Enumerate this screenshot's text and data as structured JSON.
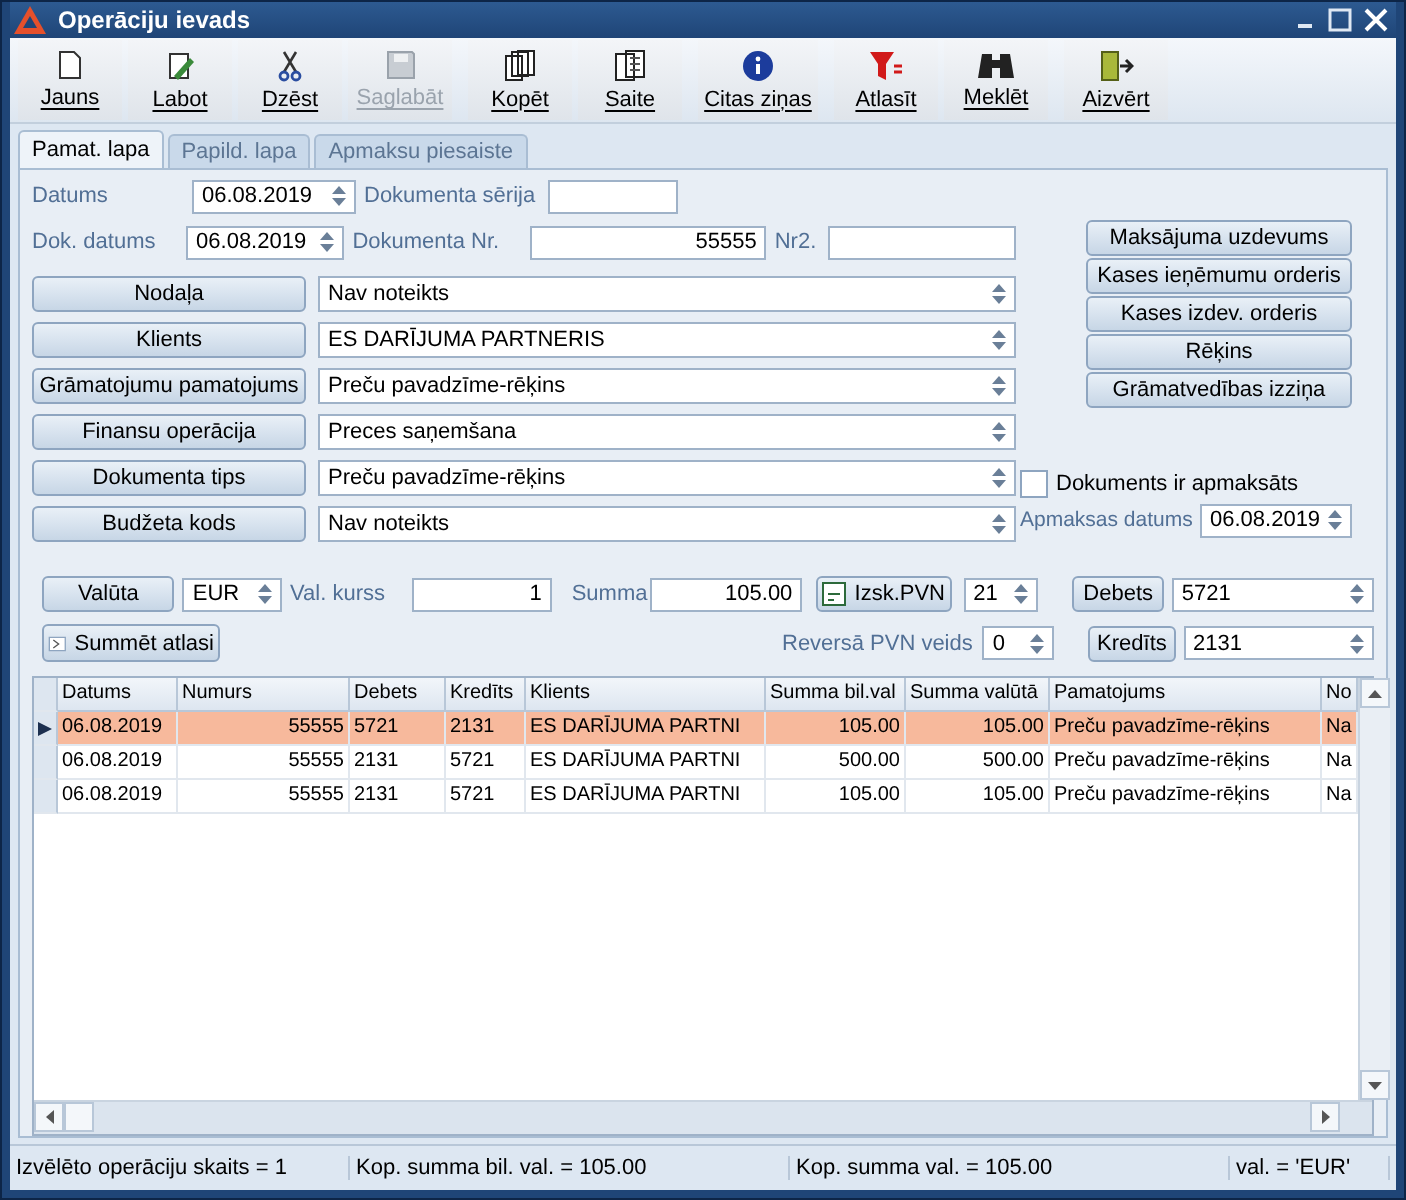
{
  "window": {
    "title": "Operāciju ievads"
  },
  "toolbar": [
    [
      {
        "label": "Jauns",
        "disabled": false
      },
      {
        "label": "Labot",
        "disabled": false
      },
      {
        "label": "Dzēst",
        "disabled": false
      },
      {
        "label": "Saglabāt",
        "disabled": true
      }
    ],
    [
      {
        "label": "Kopēt",
        "disabled": false
      },
      {
        "label": "Saite",
        "disabled": false
      }
    ],
    [
      {
        "label": "Citas ziņas",
        "disabled": false
      }
    ],
    [
      {
        "label": "Atlasīt",
        "disabled": false
      },
      {
        "label": "Meklēt",
        "disabled": false
      }
    ],
    [
      {
        "label": "Aizvērt",
        "disabled": false
      }
    ]
  ],
  "tabs": [
    {
      "label": "Pamat. lapa",
      "selected": true
    },
    {
      "label": "Papild. lapa",
      "selected": false
    },
    {
      "label": "Apmaksu piesaiste",
      "selected": false
    }
  ],
  "dates": {
    "datums": {
      "label": "Datums",
      "value": "06.08.2019"
    },
    "dok_datums": {
      "label": "Dok. datums",
      "value": "06.08.2019"
    }
  },
  "document": {
    "series_label": "Dokumenta sērija",
    "number_label": "Dokumenta Nr.",
    "number": "55555",
    "nr2_label": "Nr2."
  },
  "lookups": [
    {
      "button": "Nodaļa",
      "value": "Nav noteikts"
    },
    {
      "button": "Klients",
      "value": "ES DARĪJUMA PARTNERIS"
    },
    {
      "button": "Grāmatojumu pamatojums",
      "value": "Preču pavadzīme-rēķins"
    },
    {
      "button": "Finansu operācija",
      "value": "Preces saņemšana"
    },
    {
      "button": "Dokumenta tips",
      "value": "Preču pavadzīme-rēķins"
    },
    {
      "button": "Budžeta kods",
      "value": "Nav noteikts"
    }
  ],
  "document_buttons": [
    "Maksājuma uzdevums",
    "Kases ieņēmumu orderis",
    "Kases izdev. orderis",
    "Rēķins",
    "Grāmatvedības izziņa"
  ],
  "paid": {
    "label": "Dokuments ir apmaksāts",
    "checked": false
  },
  "payment_date": {
    "label": "Apmaksas datums",
    "value": "06.08.2019"
  },
  "amounts": {
    "currency_button": "Valūta",
    "currency": "EUR",
    "rate_label": "Val. kurss",
    "rate": "1",
    "sum_label": "Summa",
    "sum": "105.00",
    "vat_button": "Izsk.PVN",
    "vat": "21",
    "debit_button": "Debets",
    "debit": "5721",
    "sum_selection_button": "Summēt atlasi",
    "reverse_vat_label": "Reversā PVN veids",
    "reverse_vat": "0",
    "credit_button": "Kredīts",
    "credit": "2131"
  },
  "grid": {
    "columns": [
      "Datums",
      "Numurs",
      "Debets",
      "Kredīts",
      "Klients",
      "Summa bil.val",
      "Summa valūtā",
      "Pamatojums",
      "No"
    ],
    "rows": [
      {
        "selected": true,
        "cells": [
          "06.08.2019",
          "55555",
          "5721",
          "2131",
          "ES DARĪJUMA PARTNI",
          "105.00",
          "105.00",
          "Preču pavadzīme-rēķins",
          "Na"
        ]
      },
      {
        "selected": false,
        "cells": [
          "06.08.2019",
          "55555",
          "2131",
          "5721",
          "ES DARĪJUMA PARTNI",
          "500.00",
          "500.00",
          "Preču pavadzīme-rēķins",
          "Na"
        ]
      },
      {
        "selected": false,
        "cells": [
          "06.08.2019",
          "55555",
          "2131",
          "5721",
          "ES DARĪJUMA PARTNI",
          "105.00",
          "105.00",
          "Preču pavadzīme-rēķins",
          "Na"
        ]
      }
    ]
  },
  "status_bar": [
    "Izvēlēto operāciju skaits = 1",
    "Kop. summa bil. val. =  105.00",
    "Kop. summa val. =  105.00",
    "val. = 'EUR'"
  ]
}
